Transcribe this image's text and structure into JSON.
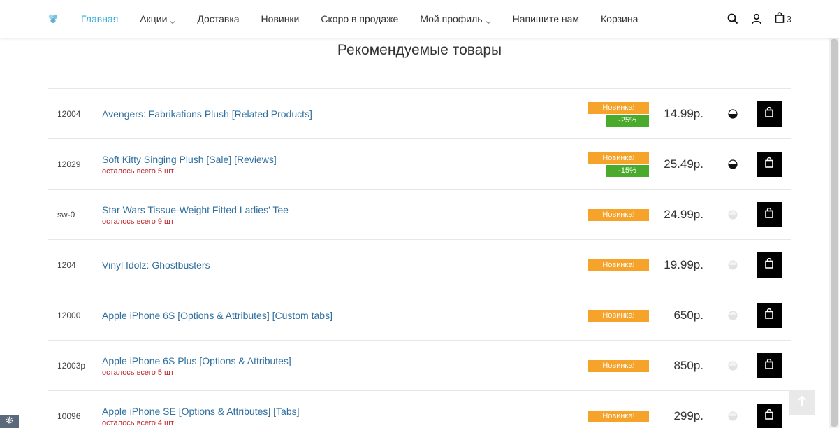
{
  "nav": {
    "items": [
      {
        "label": "Главная",
        "active": true,
        "dropdown": false
      },
      {
        "label": "Акции",
        "active": false,
        "dropdown": true
      },
      {
        "label": "Доставка",
        "active": false,
        "dropdown": false
      },
      {
        "label": "Новинки",
        "active": false,
        "dropdown": false
      },
      {
        "label": "Скоро в продаже",
        "active": false,
        "dropdown": false
      },
      {
        "label": "Мой профиль",
        "active": false,
        "dropdown": true
      },
      {
        "label": "Напишите нам",
        "active": false,
        "dropdown": false
      },
      {
        "label": "Корзина",
        "active": false,
        "dropdown": false
      }
    ]
  },
  "header": {
    "cart_count": "3",
    "icons": [
      "logo-icon",
      "search-icon",
      "user-icon",
      "cart-bag-icon"
    ]
  },
  "section": {
    "title": "Рекомендуемые товары"
  },
  "products": [
    {
      "code": "12004",
      "name": "Avengers: Fabrikations Plush [Related Products]",
      "stock_note": "",
      "badge_new": "Новинка!",
      "badge_sale": "-25%",
      "price": "14.99р.",
      "stock_level": "partial"
    },
    {
      "code": "12029",
      "name": "Soft Kitty Singing Plush [Sale] [Reviews]",
      "stock_note": "осталось всего 5 шт",
      "badge_new": "Новинка!",
      "badge_sale": "-15%",
      "price": "25.49р.",
      "stock_level": "partial"
    },
    {
      "code": "sw-0",
      "name": "Star Wars Tissue-Weight Fitted Ladies' Tee",
      "stock_note": "осталось всего 9 шт",
      "badge_new": "Новинка!",
      "badge_sale": "",
      "price": "24.99р.",
      "stock_level": "empty"
    },
    {
      "code": "1204",
      "name": "Vinyl Idolz: Ghostbusters",
      "stock_note": "",
      "badge_new": "Новинка!",
      "badge_sale": "",
      "price": "19.99р.",
      "stock_level": "empty"
    },
    {
      "code": "12000",
      "name": "Apple iPhone 6S [Options & Attributes] [Custom tabs]",
      "stock_note": "",
      "badge_new": "Новинка!",
      "badge_sale": "",
      "price": "650р.",
      "stock_level": "empty"
    },
    {
      "code": "12003p",
      "name": "Apple iPhone 6S Plus [Options & Attributes]",
      "stock_note": "осталось всего 5 шт",
      "badge_new": "Новинка!",
      "badge_sale": "",
      "price": "850р.",
      "stock_level": "empty"
    },
    {
      "code": "10096",
      "name": "Apple iPhone SE [Options & Attributes] [Tabs]",
      "stock_note": "осталось всего 4 шт",
      "badge_new": "Новинка!",
      "badge_sale": "",
      "price": "299р.",
      "stock_level": "empty"
    }
  ],
  "colors": {
    "accent": "#3aaed8",
    "link": "#2f6f9f",
    "badge_new": "#f5a32a",
    "badge_sale": "#4aaa2c",
    "stock_warning": "#c0262d"
  }
}
